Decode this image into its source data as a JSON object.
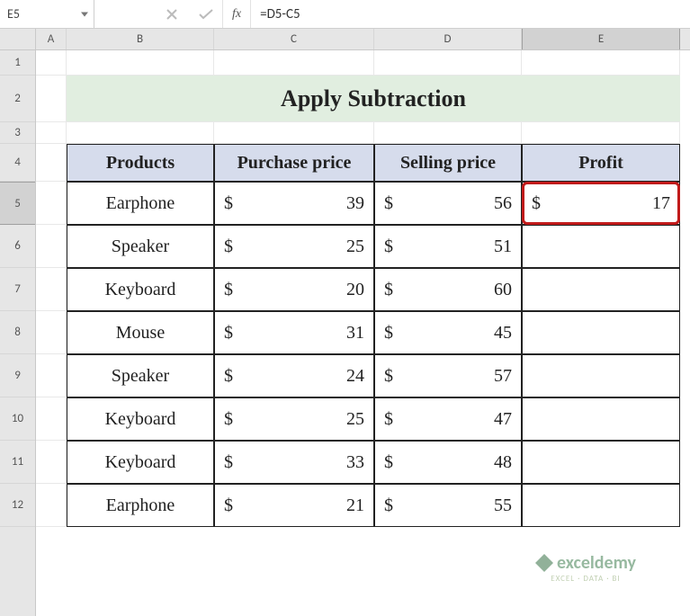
{
  "namebox": "E5",
  "formula": "=D5-C5",
  "fx_label": "fx",
  "columns": [
    "A",
    "B",
    "C",
    "D",
    "E"
  ],
  "rows": [
    "1",
    "2",
    "3",
    "4",
    "5",
    "6",
    "7",
    "8",
    "9",
    "10",
    "11",
    "12"
  ],
  "selected_cell": "E5",
  "title": "Apply Subtraction",
  "table": {
    "headers": [
      "Products",
      "Purchase price",
      "Selling price",
      "Profit"
    ],
    "rows": [
      {
        "product": "Earphone",
        "purchase": 39,
        "selling": 56,
        "profit": 17
      },
      {
        "product": "Speaker",
        "purchase": 25,
        "selling": 51,
        "profit": ""
      },
      {
        "product": "Keyboard",
        "purchase": 20,
        "selling": 60,
        "profit": ""
      },
      {
        "product": "Mouse",
        "purchase": 31,
        "selling": 45,
        "profit": ""
      },
      {
        "product": "Speaker",
        "purchase": 24,
        "selling": 57,
        "profit": ""
      },
      {
        "product": "Keyboard",
        "purchase": 25,
        "selling": 47,
        "profit": ""
      },
      {
        "product": "Keyboard",
        "purchase": 33,
        "selling": 48,
        "profit": ""
      },
      {
        "product": "Earphone",
        "purchase": 21,
        "selling": 55,
        "profit": ""
      }
    ],
    "currency": "$"
  },
  "watermark": {
    "brand": "exceldemy",
    "tag": "EXCEL · DATA · BI"
  },
  "chart_data": {
    "type": "table",
    "title": "Apply Subtraction",
    "columns": [
      "Products",
      "Purchase price",
      "Selling price",
      "Profit"
    ],
    "rows": [
      [
        "Earphone",
        39,
        56,
        17
      ],
      [
        "Speaker",
        25,
        51,
        null
      ],
      [
        "Keyboard",
        20,
        60,
        null
      ],
      [
        "Mouse",
        31,
        45,
        null
      ],
      [
        "Speaker",
        24,
        57,
        null
      ],
      [
        "Keyboard",
        25,
        47,
        null
      ],
      [
        "Keyboard",
        33,
        48,
        null
      ],
      [
        "Earphone",
        21,
        55,
        null
      ]
    ]
  }
}
